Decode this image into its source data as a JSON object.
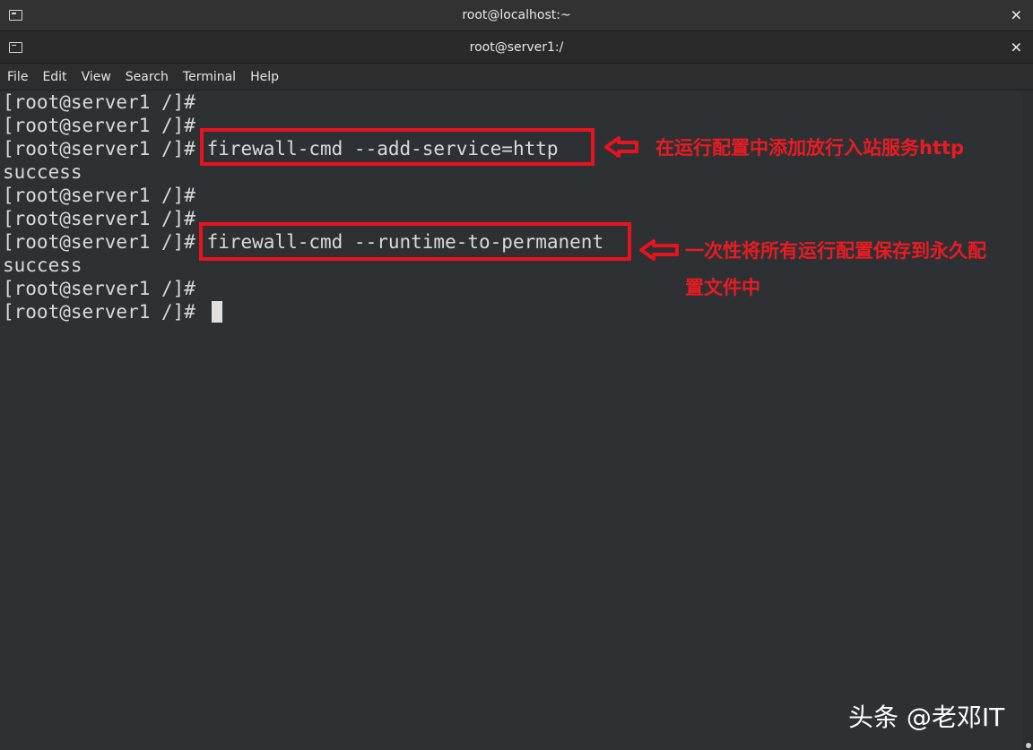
{
  "windows": {
    "outer_title": "root@localhost:~",
    "inner_title": "root@server1:/"
  },
  "icons": {
    "terminal": "terminal-icon",
    "close": "close-icon"
  },
  "menu": [
    "File",
    "Edit",
    "View",
    "Search",
    "Terminal",
    "Help"
  ],
  "terminal": {
    "lines": [
      "[root@server1 /]#",
      "[root@server1 /]#",
      "[root@server1 /]# firewall-cmd --add-service=http",
      "success",
      "[root@server1 /]#",
      "[root@server1 /]#",
      "[root@server1 /]# firewall-cmd --runtime-to-permanent",
      "success",
      "[root@server1 /]#",
      "[root@server1 /]# "
    ]
  },
  "annotations": {
    "note1": "在运行配置中添加放行入站服务http",
    "note2_line1": "一次性将所有运行配置保存到永久配",
    "note2_line2": "置文件中",
    "color": "#e8131f"
  },
  "watermark": "头条 @老邓IT"
}
